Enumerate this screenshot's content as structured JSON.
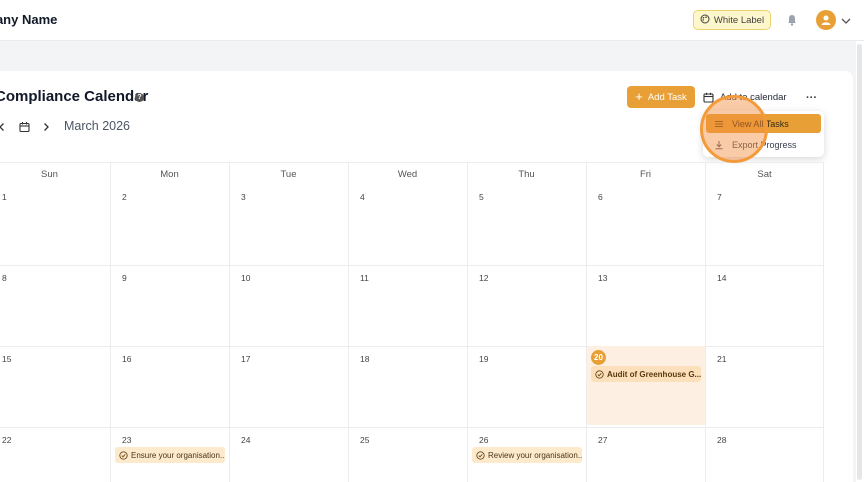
{
  "header": {
    "company_name": "pany Name",
    "white_label": "White Label"
  },
  "page": {
    "title": "Compliance Calendar",
    "help_glyph": "?",
    "month": "March 2026"
  },
  "toolbar": {
    "add_task": "Add Task",
    "add_to_calendar": "Add to calendar",
    "more": "···"
  },
  "dropdown": {
    "items": [
      {
        "label": "View All Tasks",
        "icon": "list-icon",
        "active": true
      },
      {
        "label": "Export Progress",
        "icon": "download-icon",
        "active": false
      }
    ]
  },
  "calendar": {
    "weekdays": [
      "Sun",
      "Mon",
      "Tue",
      "Wed",
      "Thu",
      "Fri",
      "Sat"
    ],
    "weeks": [
      [
        "1",
        "2",
        "3",
        "4",
        "5",
        "6",
        "7"
      ],
      [
        "8",
        "9",
        "10",
        "11",
        "12",
        "13",
        "14"
      ],
      [
        "15",
        "16",
        "17",
        "18",
        "19",
        "20",
        "21"
      ],
      [
        "22",
        "23",
        "24",
        "25",
        "26",
        "27",
        "28"
      ]
    ],
    "today": "20",
    "events": [
      {
        "day": "20",
        "label": "Audit of Greenhouse G..."
      },
      {
        "day": "23",
        "label": "Ensure your organisation..."
      },
      {
        "day": "26",
        "label": "Review your organisation..."
      }
    ]
  },
  "colors": {
    "accent": "#e8a036",
    "today_bg": "#fdf0e3",
    "white_label_bg": "#fff7cc"
  }
}
